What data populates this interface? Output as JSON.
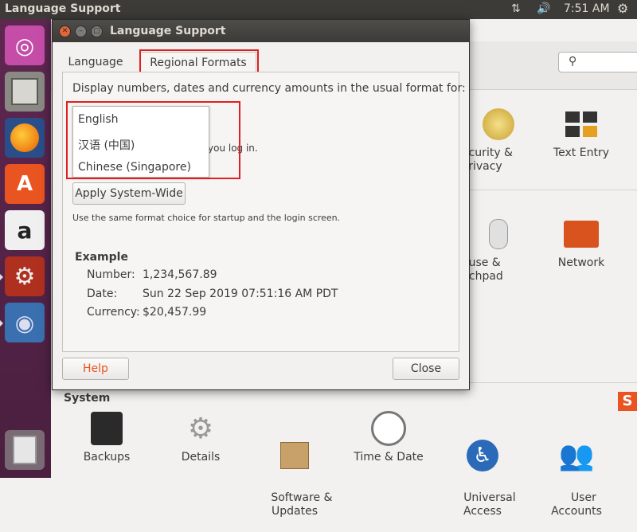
{
  "top_panel": {
    "title": "Language Support",
    "time": "7:51 AM",
    "icons": [
      "network-arrows-icon",
      "volume-icon",
      "settings-gear-icon"
    ]
  },
  "launcher": {
    "items": [
      "Ubuntu Dash",
      "Files",
      "Firefox Web Browser",
      "Ubuntu Software",
      "Amazon",
      "System Settings",
      "Language Support"
    ],
    "trash": "Trash"
  },
  "settings": {
    "items_row1": [
      {
        "label": "Security & Privacy",
        "visible": "ecurity &\nPrivacy"
      },
      {
        "label": "Text Entry"
      }
    ],
    "items_row2": [
      {
        "label": "Mouse & Touchpad",
        "visible": "ouse &\nuchpad"
      },
      {
        "label": "Network"
      }
    ],
    "system_section": "System",
    "system_items": [
      {
        "label": "Backups"
      },
      {
        "label": "Details"
      },
      {
        "label": "Software &\nUpdates"
      },
      {
        "label": "Time & Date"
      },
      {
        "label": "Universal\nAccess"
      },
      {
        "label": "User\nAccounts"
      }
    ]
  },
  "dialog": {
    "title": "Language Support",
    "tabs": {
      "language": "Language",
      "regional": "Regional Formats"
    },
    "instruction": "Display numbers, dates and currency amounts in the usual format for:",
    "dropdown_options": [
      "English",
      "汉语 (中国)",
      "Chinese (Singapore)"
    ],
    "hidden_note_fragment": "you log in.",
    "apply_button": "Apply System-Wide",
    "note": "Use the same format choice for startup and the login screen.",
    "example": {
      "title": "Example",
      "number_label": "Number:",
      "number_value": "1,234,567.89",
      "date_label": "Date:",
      "date_value": "Sun 22 Sep 2019 07:51:16 AM PDT",
      "currency_label": "Currency:",
      "currency_value": "$20,457.99"
    },
    "help_button": "Help",
    "close_button": "Close"
  },
  "colors": {
    "launcher": "#5e2750",
    "highlight": "#e02020",
    "help_text": "#e95420"
  }
}
